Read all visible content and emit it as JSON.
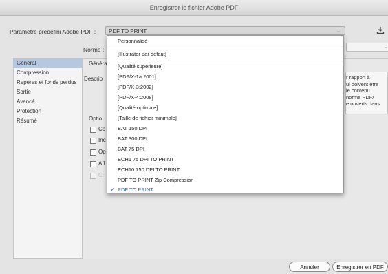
{
  "window": {
    "title": "Enregistrer le fichier Adobe PDF"
  },
  "preset": {
    "label": "Paramètre prédéfini Adobe PDF :",
    "value": "PDF TO PRINT"
  },
  "norme": {
    "label": "Norme :"
  },
  "sidebar": {
    "items": [
      {
        "label": "Général"
      },
      {
        "label": "Compression"
      },
      {
        "label": "Repères et fonds perdus"
      },
      {
        "label": "Sortie"
      },
      {
        "label": "Avancé"
      },
      {
        "label": "Protection"
      },
      {
        "label": "Résumé"
      }
    ]
  },
  "panel": {
    "section_title": "Général",
    "description_label": "Descrip",
    "description_lines": [
      "r rapport à",
      "ui doivent être",
      "le contenu",
      "norme PDF/",
      "e ouverts dans"
    ],
    "options_label": "Optio",
    "checkboxes": [
      {
        "label": "Co"
      },
      {
        "label": "Inc"
      },
      {
        "label": "Op"
      },
      {
        "label": "Aff"
      },
      {
        "label": "Cr"
      }
    ]
  },
  "dropdown": {
    "items": [
      {
        "label": "Personnalisé"
      },
      {
        "label": "[Illustrator par défaut]"
      },
      {
        "label": "[Qualité supérieure]"
      },
      {
        "label": "[PDF/X-1a:2001]"
      },
      {
        "label": "[PDF/X-3:2002]"
      },
      {
        "label": "[PDF/X-4:2008]"
      },
      {
        "label": "[Qualité optimale]"
      },
      {
        "label": "[Taille de fichier minimale]"
      },
      {
        "label": "BAT 150 DPI"
      },
      {
        "label": "BAT 300 DPI"
      },
      {
        "label": "BAT 75 DPI"
      },
      {
        "label": "ECH1 75 DPI TO PRINT"
      },
      {
        "label": "ECH10 750 DPI TO PRINT"
      },
      {
        "label": "PDF TO PRINT Zip Compression"
      },
      {
        "label": "PDF TO PRINT",
        "selected": true
      }
    ]
  },
  "buttons": {
    "cancel": "Annuler",
    "save": "Enregistrer en PDF"
  },
  "colors": {
    "selected_item": "#2a63c4",
    "sidebar_active": "#b6c8e0"
  }
}
